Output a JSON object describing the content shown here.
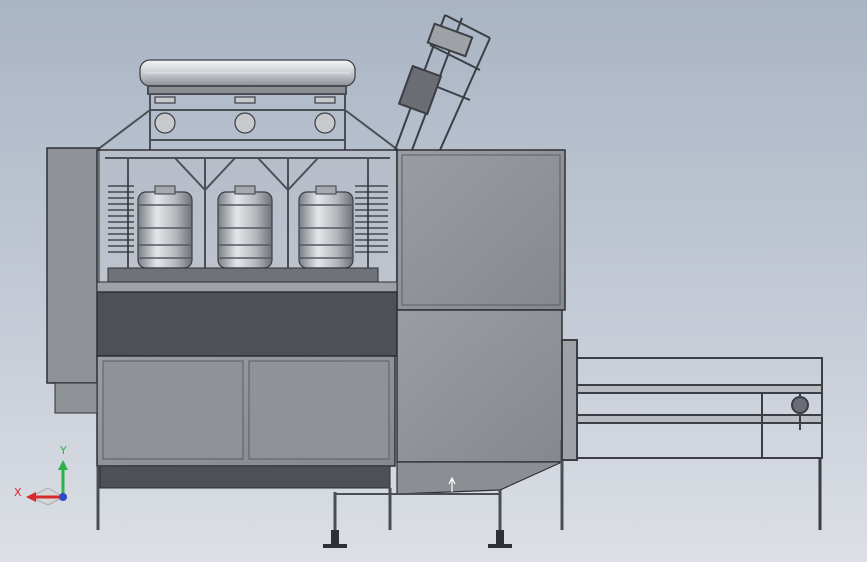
{
  "viewport": {
    "background_top": "#a9b4c4",
    "background_bottom": "#dcdfe5"
  },
  "model": {
    "bottles": [
      {
        "name": "bottle-left"
      },
      {
        "name": "bottle-middle"
      },
      {
        "name": "bottle-right"
      }
    ],
    "colors": {
      "frame": "#5a5e65",
      "panel": "#8b8e93",
      "panel_light": "#9c9fa4",
      "dark_band": "#4d5056",
      "outline": "#2e3035",
      "bottle": "#b9bcc1",
      "tank": "#d4d6da"
    }
  },
  "triad": {
    "x_label": "X",
    "y_label": "Y",
    "x_color": "#d8282a",
    "y_color": "#2bb34a",
    "z_color": "#2f49c7"
  }
}
